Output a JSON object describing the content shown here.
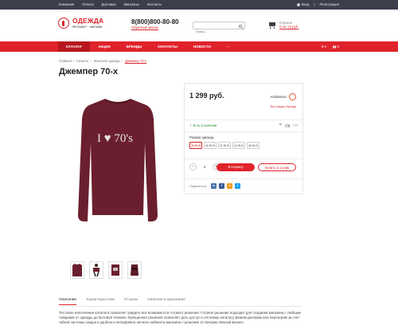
{
  "topbar": {
    "links": [
      "Компания",
      "Оплата",
      "Доставка",
      "Магазины",
      "Контакты"
    ],
    "login": "Вход",
    "register": "Регистрация"
  },
  "header": {
    "logo_title": "ОДЕЖДА",
    "logo_subtitle": "Интернет - магазин",
    "phone": "8(800)800-80-80",
    "callback": "Обратный звонок",
    "search_placeholder": "Поиск...",
    "cart_title": "Корзина",
    "cart_summary": "0 шт. | 0 руб."
  },
  "nav": {
    "items": [
      "КАТАЛОГ",
      "АКЦИИ",
      "БРЕНДЫ",
      "КОНТАКТЫ",
      "НОВОСТИ",
      "···"
    ],
    "fav_count": "0",
    "compare_count": "0"
  },
  "breadcrumbs": [
    "Главная",
    "Каталог",
    "Женская одежда",
    "Джемпер 70-х"
  ],
  "product": {
    "title": "Джемпер 70-х",
    "print_text": "I ♥ 70's",
    "price": "1 299 руб.",
    "brand_name": "Aimlasson",
    "brand_link": "Все товары бренда",
    "availability": "Есть в наличии",
    "compare_label": "Cpr",
    "size_label": "Размер одежды",
    "sizes": [
      "38 RUS",
      "40 RUS",
      "42 RUS",
      "44 RUS",
      "46 RUS"
    ],
    "selected_size": "38 RUS",
    "quantity": "1",
    "buy_label": "В корзину",
    "one_click_label": "Купить в 1 клик",
    "share_label": "Поделиться:"
  },
  "colors": {
    "accent": "#e0232b",
    "dark": "#3a3f4b",
    "garment": "#6b1f2e"
  },
  "tabs": [
    "Описание",
    "Характеристики",
    "Отзывы",
    "Наличие в магазинах"
  ],
  "description": "Тестовое наполнение каталога позволяет увидеть все возможности готового решения. Готовое решение подходит для создания магазина с любыми товарами от одежды до бытовой техники. Функционал решения позволяет дать доступ к оптовому каталогу Вашим дилерам или партнерам за счет гибкой системы скидок и удобного интерфейса личного кабинета магазина с решения 1С-Битрикс:Малый Бизнес."
}
